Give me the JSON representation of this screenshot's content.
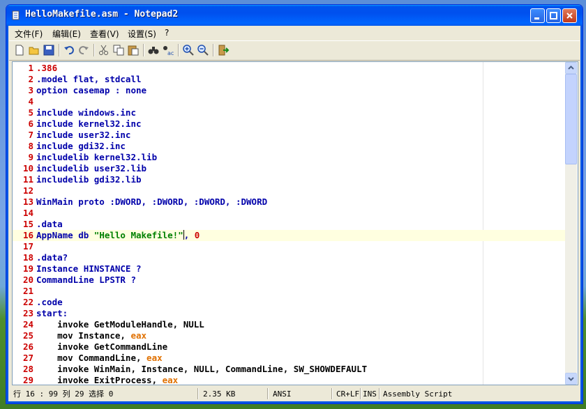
{
  "window": {
    "title": "HelloMakefile.asm - Notepad2"
  },
  "menu": [
    "文件(F)",
    "编辑(E)",
    "查看(V)",
    "设置(S)",
    "?"
  ],
  "toolbar_icons": [
    "new-file-icon",
    "open-folder-icon",
    "save-icon",
    "undo-icon",
    "redo-icon",
    "cut-icon",
    "copy-icon",
    "paste-icon",
    "find-icon",
    "replace-icon",
    "zoom-in-icon",
    "zoom-out-icon",
    "exit-icon"
  ],
  "editor": {
    "current_line": 16,
    "lines": [
      [
        {
          "t": ".386",
          "c": "#cc0000"
        }
      ],
      [
        {
          "t": ".model flat, stdcall",
          "c": "#0000aa"
        }
      ],
      [
        {
          "t": "option casemap : none",
          "c": "#0000aa"
        }
      ],
      [],
      [
        {
          "t": "include windows.inc",
          "c": "#0000aa"
        }
      ],
      [
        {
          "t": "include kernel32.inc",
          "c": "#0000aa"
        }
      ],
      [
        {
          "t": "include user32.inc",
          "c": "#0000aa"
        }
      ],
      [
        {
          "t": "include gdi32.inc",
          "c": "#0000aa"
        }
      ],
      [
        {
          "t": "includelib kernel32.lib",
          "c": "#0000aa"
        }
      ],
      [
        {
          "t": "includelib user32.lib",
          "c": "#0000aa"
        }
      ],
      [
        {
          "t": "includelib gdi32.lib",
          "c": "#0000aa"
        }
      ],
      [],
      [
        {
          "t": "WinMain proto :DWORD, :DWORD, :DWORD, :DWORD",
          "c": "#0000aa"
        }
      ],
      [],
      [
        {
          "t": ".data",
          "c": "#0000aa"
        }
      ],
      [
        {
          "t": "AppName db ",
          "c": "#0000aa"
        },
        {
          "t": "\"Hello Makefile!\"",
          "c": "#008000"
        },
        {
          "t": "CARET"
        },
        {
          "t": ", ",
          "c": "#0000aa"
        },
        {
          "t": "0",
          "c": "#cc0000"
        }
      ],
      [],
      [
        {
          "t": ".data?",
          "c": "#0000aa"
        }
      ],
      [
        {
          "t": "Instance HINSTANCE ?",
          "c": "#0000aa"
        }
      ],
      [
        {
          "t": "CommandLine LPSTR ?",
          "c": "#0000aa"
        }
      ],
      [],
      [
        {
          "t": ".code",
          "c": "#0000aa"
        }
      ],
      [
        {
          "t": "start:",
          "c": "#0000aa"
        }
      ],
      [
        {
          "t": "    invoke GetModuleHandle, NULL",
          "c": "#000000"
        }
      ],
      [
        {
          "t": "    mov Instance, ",
          "c": "#000000"
        },
        {
          "t": "eax",
          "c": "#e07000"
        }
      ],
      [
        {
          "t": "    invoke GetCommandLine",
          "c": "#000000"
        }
      ],
      [
        {
          "t": "    mov CommandLine, ",
          "c": "#000000"
        },
        {
          "t": "eax",
          "c": "#e07000"
        }
      ],
      [
        {
          "t": "    invoke WinMain, Instance, NULL, CommandLine, SW_SHOWDEFAULT",
          "c": "#000000"
        }
      ],
      [
        {
          "t": "    invoke ExitProcess, ",
          "c": "#000000"
        },
        {
          "t": "eax",
          "c": "#e07000"
        }
      ]
    ]
  },
  "status": {
    "position": "行 16 : 99   列 29   选择 0",
    "size": "2.35 KB",
    "encoding": "ANSI",
    "line_ending": "CR+LF",
    "ins": "INS",
    "scheme": "Assembly Script"
  }
}
